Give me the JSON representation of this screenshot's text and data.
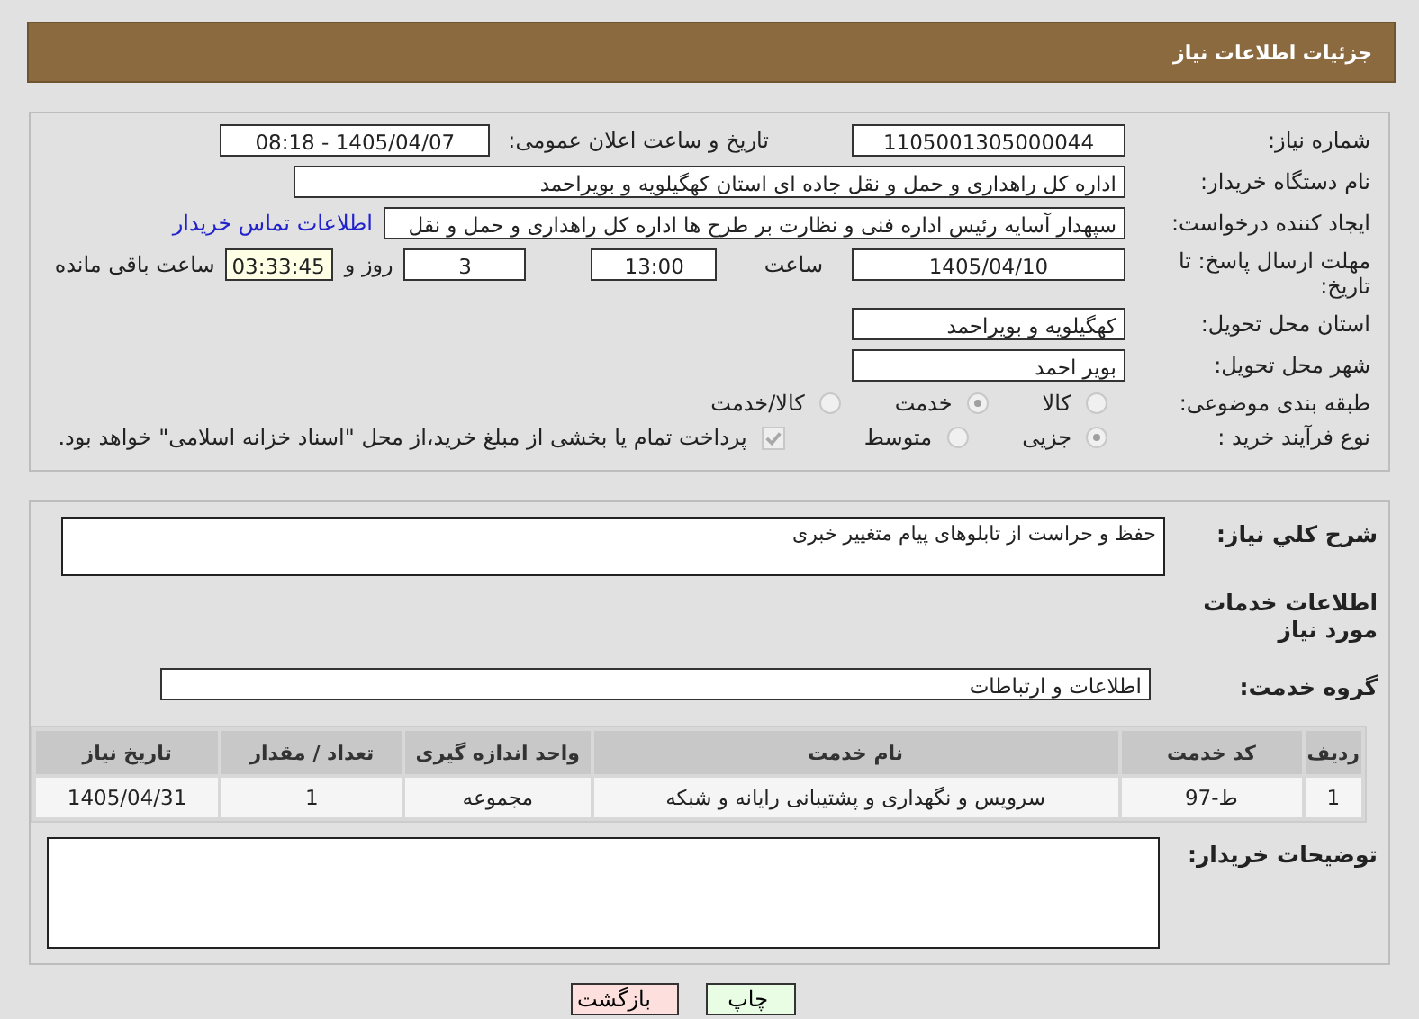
{
  "header": {
    "title": "جزئیات اطلاعات نیاز"
  },
  "need_number": {
    "label": "شماره نیاز:",
    "value": "1105001305000044"
  },
  "announce": {
    "label": "تاریخ و ساعت اعلان عمومی:",
    "value": "1405/04/07 - 08:18"
  },
  "buyer": {
    "label": "نام دستگاه خریدار:",
    "value": "اداره کل راهداری و حمل و نقل جاده ای استان کهگیلویه و بویراحمد"
  },
  "requester": {
    "label": "ایجاد کننده درخواست:",
    "value": "سپهدار آسایه رئیس اداره فنی و نظارت بر طرح ها اداره کل راهداری و حمل و نقل",
    "link": "اطلاعات تماس خریدار"
  },
  "deadline": {
    "label": "مهلت ارسال پاسخ: تا تاریخ:",
    "date": "1405/04/10",
    "time_label": "ساعت",
    "time": "13:00",
    "days": "3",
    "days_label": "روز و",
    "remaining": "03:33:45",
    "remaining_label": "ساعت باقی مانده"
  },
  "province": {
    "label": "استان محل تحویل:",
    "value": "کهگیلویه و بویراحمد"
  },
  "city": {
    "label": "شهر محل تحویل:",
    "value": "بویر احمد"
  },
  "category": {
    "label": "طبقه بندی موضوعی:",
    "options": [
      {
        "label": "کالا",
        "selected": false
      },
      {
        "label": "خدمت",
        "selected": true
      },
      {
        "label": "کالا/خدمت",
        "selected": false
      }
    ]
  },
  "process": {
    "label": "نوع فرآیند خرید :",
    "options": [
      {
        "label": "جزیی",
        "selected": true
      },
      {
        "label": "متوسط",
        "selected": false
      }
    ],
    "payment": {
      "label": "پرداخت تمام یا بخشی از مبلغ خرید،از محل \"اسناد خزانه اسلامی\" خواهد بود.",
      "checked": true
    }
  },
  "description": {
    "label": "شرح كلي نياز:",
    "value": "حفظ و حراست از تابلوهای پیام متغییر خبری"
  },
  "services_title": "اطلاعات خدمات مورد نیاز",
  "service_group": {
    "label": "گروه خدمت:",
    "value": "اطلاعات و ارتباطات"
  },
  "table": {
    "columns": [
      "ردیف",
      "کد خدمت",
      "نام خدمت",
      "واحد اندازه گیری",
      "تعداد / مقدار",
      "تاریخ نیاز"
    ],
    "rows": [
      [
        "1",
        "ط-97",
        "سرویس و نگهداری و پشتیبانی رایانه و شبکه",
        "مجموعه",
        "1",
        "1405/04/31"
      ]
    ]
  },
  "buyer_notes": {
    "label": "توضیحات خریدار:"
  },
  "buttons": [
    {
      "label": "چاپ",
      "kind": "print"
    },
    {
      "label": "بازگشت",
      "kind": "back"
    }
  ]
}
